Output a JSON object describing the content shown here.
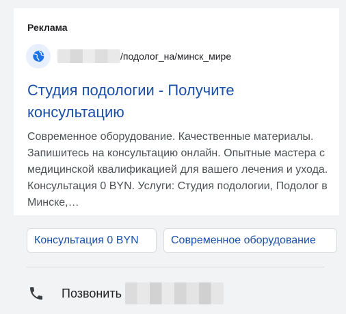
{
  "ad": {
    "label": "Реклама",
    "site_icon": "globe-icon",
    "url_path": "/подолог_на/минск_мире",
    "headline": "Студия подологии - Получите консультацию",
    "description": "Современное оборудование. Качественные материалы. Запишитесь на консультацию онлайн. Опытные мастера с медицинской квалификацией для вашего лечения и ухода. Консультация 0 BYN. Услуги: Студия подологии, Подолог в Минске,…"
  },
  "sitelinks": [
    {
      "label": "Консультация 0 BYN"
    },
    {
      "label": "Современное оборудование"
    }
  ],
  "call": {
    "icon": "phone-icon",
    "label": "Позвонить"
  },
  "colors": {
    "headline": "#1a4fa8",
    "link": "#1a4fa8",
    "text": "#4d5156",
    "background": "#f1f3f4",
    "card": "#ffffff"
  }
}
